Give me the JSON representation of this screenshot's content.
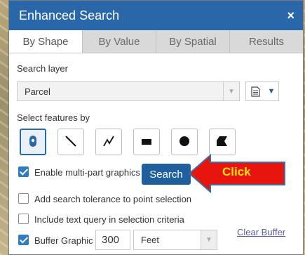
{
  "window": {
    "title": "Enhanced Search",
    "close_glyph": "×"
  },
  "tabs": [
    {
      "label": "By Shape",
      "active": true
    },
    {
      "label": "By Value",
      "active": false
    },
    {
      "label": "By Spatial",
      "active": false
    },
    {
      "label": "Results",
      "active": false
    }
  ],
  "search_layer": {
    "label": "Search layer",
    "value": "Parcel"
  },
  "select_features": {
    "label": "Select features by",
    "tools": [
      {
        "icon": "point-icon",
        "active": true
      },
      {
        "icon": "line-icon",
        "active": false
      },
      {
        "icon": "polyline-icon",
        "active": false
      },
      {
        "icon": "rectangle-icon",
        "active": false
      },
      {
        "icon": "circle-icon",
        "active": false
      },
      {
        "icon": "polygon-icon",
        "active": false
      }
    ]
  },
  "options": {
    "multipart": {
      "label": "Enable multi-part graphics",
      "checked": true
    },
    "tolerance": {
      "label": "Add search tolerance to point selection",
      "checked": false
    },
    "text_query": {
      "label": "Include text query in selection criteria",
      "checked": false
    },
    "buffer": {
      "label": "Buffer Graphic",
      "checked": true,
      "distance": "300",
      "unit": "Feet"
    }
  },
  "search_button": {
    "label": "Search"
  },
  "clear_buffer": {
    "label": "Clear Buffer"
  },
  "callout": {
    "label": "Click",
    "color": "#e8140e",
    "text_color": "#ffe400"
  },
  "colors": {
    "titlebar": "#2a67a8",
    "button": "#1f5f9e"
  }
}
